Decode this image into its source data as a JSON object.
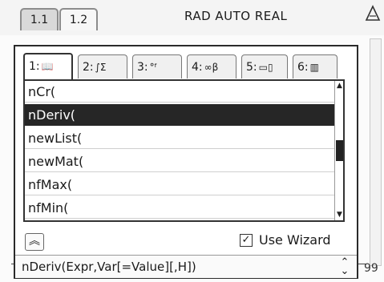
{
  "doc_tabs": [
    {
      "label": "1.1"
    },
    {
      "label": "1.2"
    }
  ],
  "status": "RAD AUTO REAL",
  "background": {
    "page_number": "99"
  },
  "catalog": {
    "tabs": [
      {
        "num": "1:",
        "icon": "catalog-book-icon",
        "glyph": "📖"
      },
      {
        "num": "2:",
        "icon": "integral-sum-icon",
        "glyph": "∫Σ"
      },
      {
        "num": "3:",
        "icon": "units-icon",
        "glyph": "°ᶠ"
      },
      {
        "num": "4:",
        "icon": "symbols-icon",
        "glyph": "∞β"
      },
      {
        "num": "5:",
        "icon": "math-templates-icon",
        "glyph": "▭▯"
      },
      {
        "num": "6:",
        "icon": "library-icon",
        "glyph": "▥"
      }
    ],
    "items": [
      {
        "label": "nCr(",
        "selected": false
      },
      {
        "label": "nDeriv(",
        "selected": true
      },
      {
        "label": "newList(",
        "selected": false
      },
      {
        "label": "newMat(",
        "selected": false
      },
      {
        "label": "nfMax(",
        "selected": false
      },
      {
        "label": "nfMin(",
        "selected": false
      }
    ],
    "use_wizard_label": "Use Wizard",
    "use_wizard_checked": true,
    "syntax": "nDeriv(Expr,Var[=Value][,H])"
  }
}
